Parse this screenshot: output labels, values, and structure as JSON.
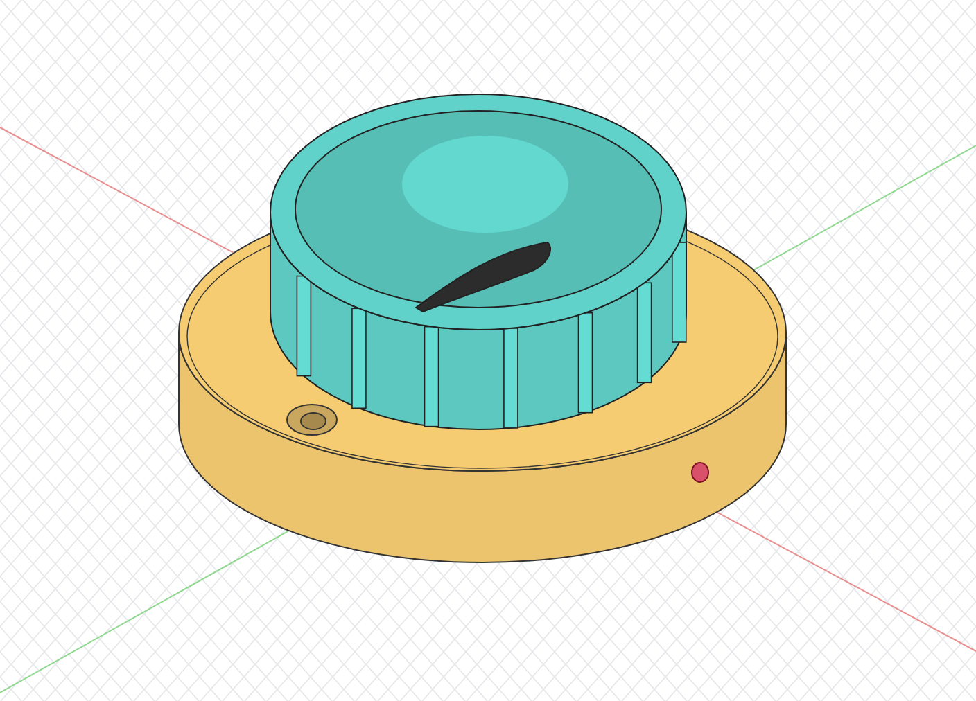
{
  "parts": [
    {
      "kind": "base",
      "color": "#ecc46e"
    },
    {
      "kind": "knob",
      "color": "#5cc8c0"
    }
  ]
}
